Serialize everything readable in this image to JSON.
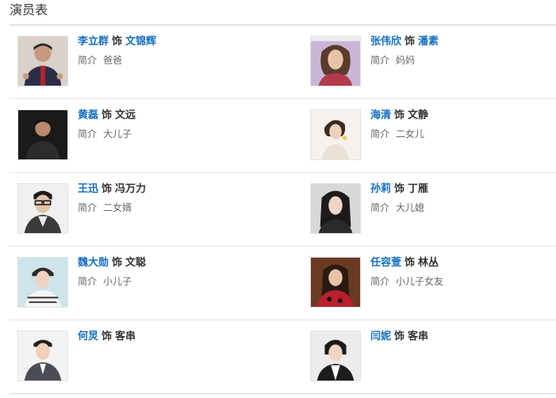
{
  "section": {
    "title": "演员表"
  },
  "cast_rows": [
    {
      "left": {
        "actor": "李立群",
        "as": "饰",
        "role": "文锦辉",
        "role_linked": true,
        "intro_label": "简介",
        "intro": "爸爸"
      },
      "right": {
        "actor": "张伟欣",
        "as": "饰",
        "role": "潘素",
        "role_linked": true,
        "intro_label": "简介",
        "intro": "妈妈"
      }
    },
    {
      "left": {
        "actor": "黄磊",
        "as": "饰",
        "role": "文远",
        "role_linked": false,
        "intro_label": "简介",
        "intro": "大儿子"
      },
      "right": {
        "actor": "海清",
        "as": "饰",
        "role": "文静",
        "role_linked": false,
        "intro_label": "简介",
        "intro": "二女儿"
      }
    },
    {
      "left": {
        "actor": "王迅",
        "as": "饰",
        "role": "冯万力",
        "role_linked": false,
        "intro_label": "简介",
        "intro": "二女婿"
      },
      "right": {
        "actor": "孙莉",
        "as": "饰",
        "role": "丁雁",
        "role_linked": false,
        "intro_label": "简介",
        "intro": "大儿媳"
      }
    },
    {
      "left": {
        "actor": "魏大勋",
        "as": "饰",
        "role": "文聪",
        "role_linked": false,
        "intro_label": "简介",
        "intro": "小儿子"
      },
      "right": {
        "actor": "任容萱",
        "as": "饰",
        "role": "林丛",
        "role_linked": false,
        "intro_label": "简介",
        "intro": "小儿子女友"
      }
    },
    {
      "left": {
        "actor": "何炅",
        "as": "饰",
        "role": "客串",
        "role_linked": false,
        "intro_label": "",
        "intro": ""
      },
      "right": {
        "actor": "闫妮",
        "as": "饰",
        "role": "客串",
        "role_linked": false,
        "intro_label": "",
        "intro": ""
      }
    }
  ],
  "colors": {
    "link": "#136ec2",
    "text": "#333333",
    "muted": "#666666",
    "divider": "#e6e6e6"
  },
  "icons": {
    "photo": "actor-photo"
  }
}
